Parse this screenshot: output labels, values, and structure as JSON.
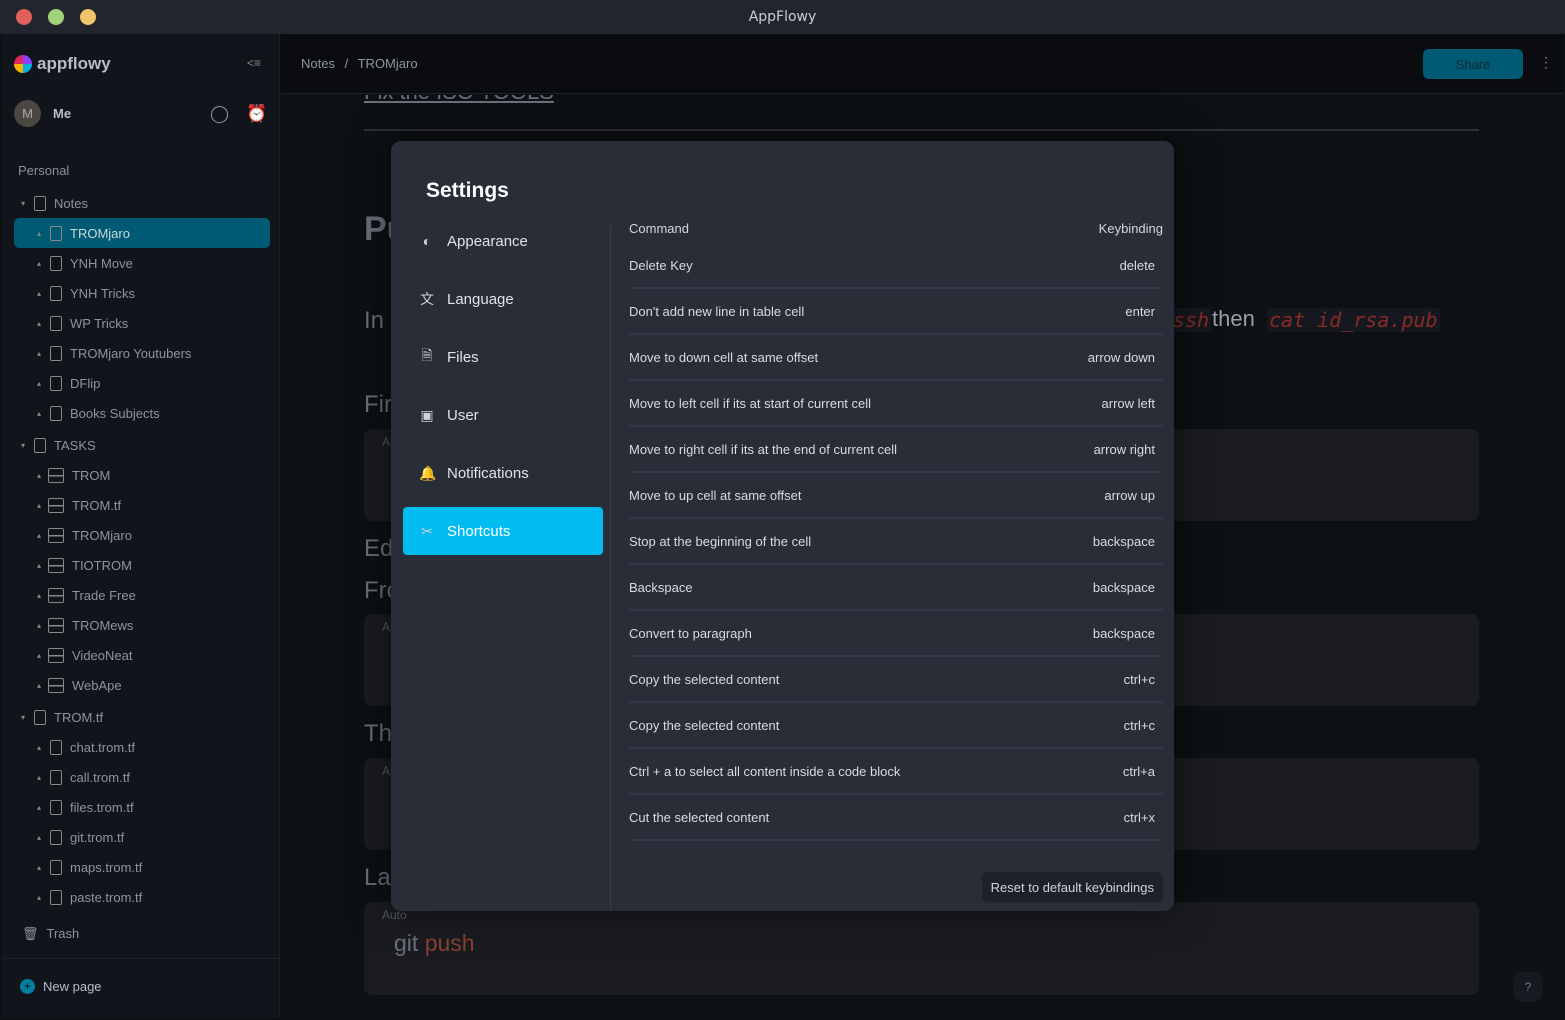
{
  "window": {
    "title": "AppFlowy"
  },
  "sidebar": {
    "brand": "appflowy",
    "user": {
      "initial": "M",
      "name": "Me"
    },
    "section": "Personal",
    "tree": [
      {
        "label": "Notes",
        "level": 1,
        "icon": "doc"
      },
      {
        "label": "TROMjaro",
        "level": 2,
        "icon": "doc",
        "active": true
      },
      {
        "label": "YNH Move",
        "level": 2,
        "icon": "doc"
      },
      {
        "label": "YNH Tricks",
        "level": 2,
        "icon": "doc"
      },
      {
        "label": "WP Tricks",
        "level": 2,
        "icon": "doc"
      },
      {
        "label": "TROMjaro Youtubers",
        "level": 2,
        "icon": "doc"
      },
      {
        "label": "DFlip",
        "level": 2,
        "icon": "doc"
      },
      {
        "label": "Books Subjects",
        "level": 2,
        "icon": "doc"
      },
      {
        "label": "TASKS",
        "level": 1,
        "icon": "doc"
      },
      {
        "label": "TROM",
        "level": 2,
        "icon": "grid"
      },
      {
        "label": "TROM.tf",
        "level": 2,
        "icon": "grid"
      },
      {
        "label": "TROMjaro",
        "level": 2,
        "icon": "grid"
      },
      {
        "label": "TIOTROM",
        "level": 2,
        "icon": "grid"
      },
      {
        "label": "Trade Free",
        "level": 2,
        "icon": "grid"
      },
      {
        "label": "TROMews",
        "level": 2,
        "icon": "grid"
      },
      {
        "label": "VideoNeat",
        "level": 2,
        "icon": "grid"
      },
      {
        "label": "WebApe",
        "level": 2,
        "icon": "grid"
      },
      {
        "label": "TROM.tf",
        "level": 1,
        "icon": "doc"
      },
      {
        "label": "chat.trom.tf",
        "level": 2,
        "icon": "doc"
      },
      {
        "label": "call.trom.tf",
        "level": 2,
        "icon": "doc"
      },
      {
        "label": "files.trom.tf",
        "level": 2,
        "icon": "doc"
      },
      {
        "label": "git.trom.tf",
        "level": 2,
        "icon": "doc"
      },
      {
        "label": "maps.trom.tf",
        "level": 2,
        "icon": "doc"
      },
      {
        "label": "paste.trom.tf",
        "level": 2,
        "icon": "doc"
      }
    ],
    "trash": "Trash",
    "new_page": "New page"
  },
  "header": {
    "breadcrumb": [
      "Notes",
      "TROMjaro"
    ],
    "separator": "/",
    "share": "Share"
  },
  "document": {
    "link": "Fix the ISO TOOLS",
    "fragments": {
      "h1": "Pu",
      "p1": "In",
      "code1": "ssh",
      "then": "then",
      "code2": "cat id_rsa.pub",
      "h2": "Fir",
      "h3": "Ed",
      "h4": "Fro",
      "h5": "Th",
      "h6": "La"
    },
    "block_label": "A",
    "last_block_label": "Auto",
    "last_code": [
      "git",
      "push"
    ]
  },
  "settings": {
    "title": "Settings",
    "nav": [
      {
        "label": "Appearance",
        "icon": "appearance-icon"
      },
      {
        "label": "Language",
        "icon": "language-icon"
      },
      {
        "label": "Files",
        "icon": "files-icon"
      },
      {
        "label": "User",
        "icon": "user-icon"
      },
      {
        "label": "Notifications",
        "icon": "bell-icon"
      },
      {
        "label": "Shortcuts",
        "icon": "scissors-icon",
        "selected": true
      }
    ],
    "columns": {
      "command": "Command",
      "keybinding": "Keybinding"
    },
    "shortcuts": [
      {
        "command": "Delete Key",
        "key": "delete"
      },
      {
        "command": "Don't add new line in table cell",
        "key": "enter"
      },
      {
        "command": "Move to down cell at same offset",
        "key": "arrow down"
      },
      {
        "command": "Move to left cell if its at start of current cell",
        "key": "arrow left"
      },
      {
        "command": "Move to right cell if its at the end of current cell",
        "key": "arrow right"
      },
      {
        "command": "Move to up cell at same offset",
        "key": "arrow up"
      },
      {
        "command": "Stop at the beginning of the cell",
        "key": "backspace"
      },
      {
        "command": "Backspace",
        "key": "backspace"
      },
      {
        "command": "Convert to paragraph",
        "key": "backspace"
      },
      {
        "command": "Copy the selected content",
        "key": "ctrl+c"
      },
      {
        "command": "Copy the selected content",
        "key": "ctrl+c"
      },
      {
        "command": "Ctrl + a to select all content inside a code block",
        "key": "ctrl+a"
      },
      {
        "command": "Cut the selected content",
        "key": "ctrl+x"
      }
    ],
    "reset": "Reset to default keybindings"
  },
  "help": "?",
  "colors": {
    "accent": "#00bcf0",
    "active_item": "#005a73",
    "modal_bg": "#282d38"
  }
}
